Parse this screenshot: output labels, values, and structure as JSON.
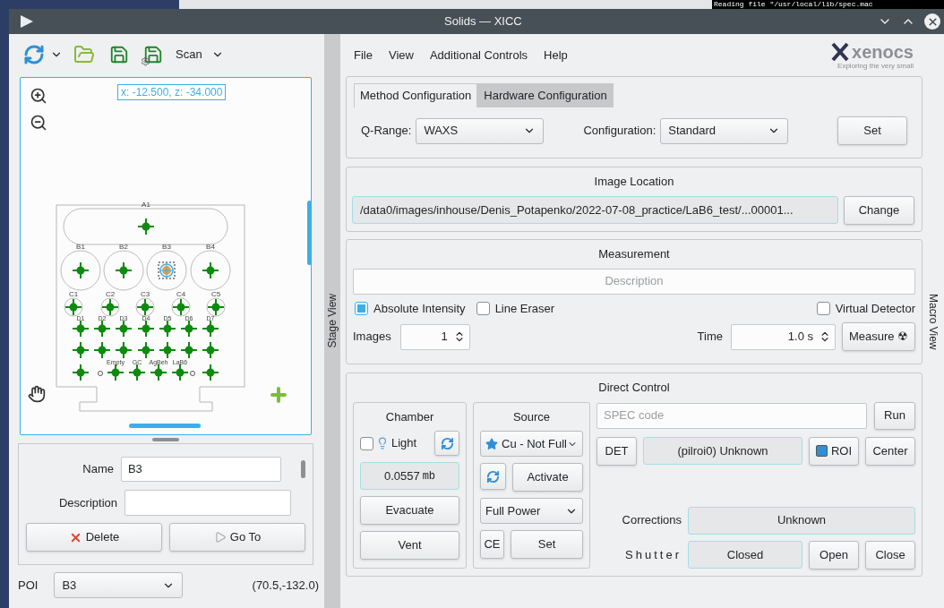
{
  "desktop": {
    "terminal_text": "Reading file \"/usr/local/lib/spec.mac"
  },
  "window": {
    "title": "Solids — XICC"
  },
  "toolbar": {
    "scan_label": "Scan"
  },
  "stage": {
    "tab_label": "Stage View",
    "coordinates": "x: -12.500, z: -34.000",
    "slot_rows": [
      {
        "slots": [
          {
            "label": "A1",
            "selected": false
          }
        ]
      },
      {
        "slots": [
          {
            "label": "B1",
            "selected": false
          },
          {
            "label": "B2",
            "selected": false
          },
          {
            "label": "B3",
            "selected": true
          },
          {
            "label": "B4",
            "selected": false
          }
        ]
      },
      {
        "slots": [
          {
            "label": "C1",
            "selected": false
          },
          {
            "label": "C2",
            "selected": false
          },
          {
            "label": "C3",
            "selected": false
          },
          {
            "label": "C4",
            "selected": false
          },
          {
            "label": "C5",
            "selected": false
          }
        ]
      },
      {
        "slots": [
          {
            "label": "D1",
            "selected": false
          },
          {
            "label": "D2",
            "selected": false
          },
          {
            "label": "D3",
            "selected": false
          },
          {
            "label": "D4",
            "selected": false
          },
          {
            "label": "D5",
            "selected": false
          },
          {
            "label": "D6",
            "selected": false
          },
          {
            "label": "D7",
            "selected": false
          }
        ]
      },
      {
        "slots": [
          {
            "selected": false
          },
          {
            "selected": false
          },
          {
            "selected": false
          },
          {
            "selected": false
          },
          {
            "selected": false
          },
          {
            "selected": false
          },
          {
            "selected": false
          }
        ]
      },
      {
        "slots": [
          {
            "selected": false
          },
          {
            "label": "Empty",
            "selected": false
          },
          {
            "label": "GC",
            "selected": false
          },
          {
            "label": "AgBeh",
            "selected": false
          },
          {
            "label": "LaB6",
            "selected": false
          },
          {
            "selected": false
          }
        ]
      }
    ]
  },
  "poi_form": {
    "name_label": "Name",
    "name_value": "B3",
    "description_label": "Description",
    "delete_button": "Delete",
    "goto_button": "Go To"
  },
  "poi_bar": {
    "label": "POI",
    "value": "B3",
    "position": "(70.5,-132.0)"
  },
  "menu": [
    "File",
    "View",
    "Additional Controls",
    "Help"
  ],
  "logo": {
    "name": "xenocs",
    "tagline": "Exploring the very small"
  },
  "tabs": [
    {
      "label": "Method Configuration",
      "selected": true
    },
    {
      "label": "Hardware Configuration",
      "selected": false
    }
  ],
  "config": {
    "qrange_label": "Q-Range:",
    "qrange_value": "WAXS",
    "configuration_label": "Configuration:",
    "configuration_value": "Standard",
    "set_button": "Set"
  },
  "image_location": {
    "title": "Image Location",
    "path": "/data0/images/inhouse/Denis_Potapenko/2022-07-08_practice/LaB6_test/...00001...",
    "change_button": "Change"
  },
  "measurement": {
    "title": "Measurement",
    "description_placeholder": "Description",
    "checkboxes": [
      {
        "label": "Absolute Intensity",
        "checked": true
      },
      {
        "label": "Line Eraser",
        "checked": false
      },
      {
        "label": "Virtual Detector",
        "checked": false
      }
    ],
    "images_label": "Images",
    "images_value": "1",
    "time_label": "Time",
    "time_value": "1.0 s",
    "measure_button": "Measure",
    "measure_symbol": "☢"
  },
  "macro_tab_label": "Macro View",
  "direct_control": {
    "title": "Direct Control",
    "chamber": {
      "title": "Chamber",
      "light_label": "Light",
      "light_checked": false,
      "pressure_value": "0.0557",
      "pressure_unit": "mb",
      "evacuate_button": "Evacuate",
      "vent_button": "Vent"
    },
    "source": {
      "title": "Source",
      "source_value": "Cu - Not Full",
      "activate_button": "Activate",
      "power_value": "Full Power",
      "ce_button": "CE",
      "set_button": "Set"
    },
    "spec_placeholder": "SPEC code",
    "run_button": "Run",
    "det_button": "DET",
    "detector_status": "(pilroi0) Unknown",
    "roi_button": "ROI",
    "center_button": "Center",
    "corrections_label": "Corrections",
    "corrections_value": "Unknown",
    "shutter_label": "Shutter",
    "shutter_value": "Closed",
    "open_button": "Open",
    "close_button": "Close"
  }
}
